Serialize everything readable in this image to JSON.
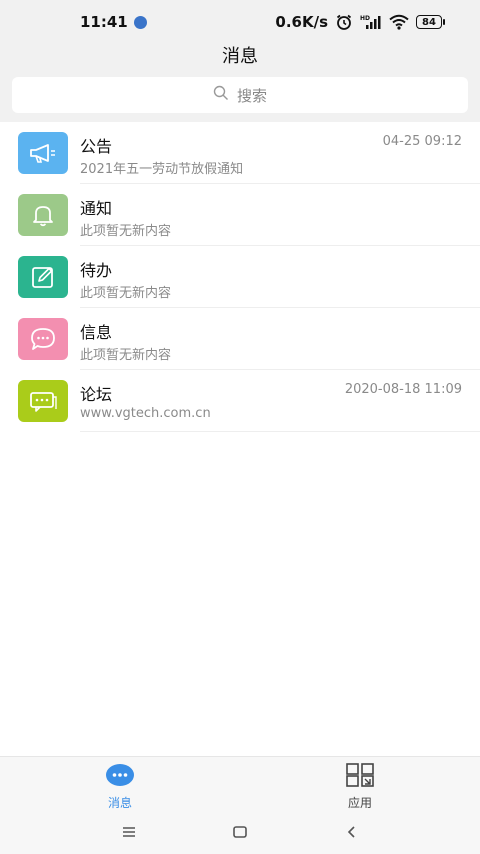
{
  "statusbar": {
    "time": "11:41",
    "net_speed": "0.6K/s",
    "battery": "84"
  },
  "header": {
    "title": "消息",
    "search_placeholder": "搜索"
  },
  "messages": [
    {
      "name": "公告",
      "subtitle": "2021年五一劳动节放假通知",
      "time": "04-25 09:12",
      "icon": "megaphone-icon",
      "color": "#5bb3f0"
    },
    {
      "name": "通知",
      "subtitle": "此项暂无新内容",
      "time": "",
      "icon": "bell-icon",
      "color": "#9cc989"
    },
    {
      "name": "待办",
      "subtitle": "此项暂无新内容",
      "time": "",
      "icon": "edit-icon",
      "color": "#2bb48f"
    },
    {
      "name": "信息",
      "subtitle": "此项暂无新内容",
      "time": "",
      "icon": "chat-bubble-icon",
      "color": "#f38fb0"
    },
    {
      "name": "论坛",
      "subtitle": "www.vgtech.com.cn",
      "time": "2020-08-18 11:09",
      "icon": "forum-icon",
      "color": "#aacc1a"
    }
  ],
  "tabs": [
    {
      "label": "消息",
      "icon": "messages-icon",
      "active": true
    },
    {
      "label": "应用",
      "icon": "apps-icon",
      "active": false
    }
  ],
  "colors": {
    "accent": "#3a8ee6",
    "header_bg": "#f1f1f1"
  }
}
